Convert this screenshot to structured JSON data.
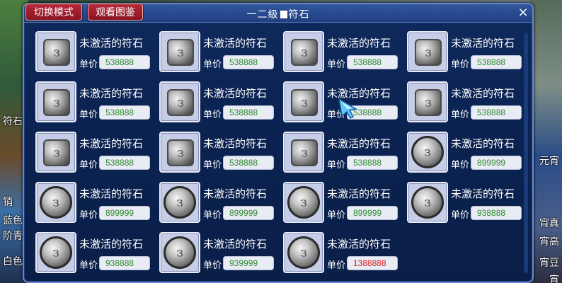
{
  "window": {
    "title_left": "一二级",
    "title_right": "符石",
    "close_glyph": "×"
  },
  "toolbar": {
    "switch_mode": "切换模式",
    "view_catalog": "观看图鉴"
  },
  "side_left": [
    "符石",
    "销",
    "蓝色符",
    "阶青",
    "白色"
  ],
  "side_right": [
    "元宵",
    "宵真",
    "宵高",
    "宵豆",
    "宵"
  ],
  "price_label": "单价",
  "items": [
    {
      "name": "未激活的符石",
      "price": "538888",
      "shape": "square",
      "price_color": "green"
    },
    {
      "name": "未激活的符石",
      "price": "538888",
      "shape": "square",
      "price_color": "green"
    },
    {
      "name": "未激活的符石",
      "price": "538888",
      "shape": "square",
      "price_color": "green"
    },
    {
      "name": "未激活的符石",
      "price": "538888",
      "shape": "square",
      "price_color": "green"
    },
    {
      "name": "未激活的符石",
      "price": "538888",
      "shape": "square",
      "price_color": "green"
    },
    {
      "name": "未激活的符石",
      "price": "538888",
      "shape": "square",
      "price_color": "green"
    },
    {
      "name": "未激活的符石",
      "price": "538888",
      "shape": "square",
      "price_color": "green"
    },
    {
      "name": "未激活的符石",
      "price": "538888",
      "shape": "square",
      "price_color": "green"
    },
    {
      "name": "未激活的符石",
      "price": "538888",
      "shape": "square",
      "price_color": "green"
    },
    {
      "name": "未激活的符石",
      "price": "538888",
      "shape": "square",
      "price_color": "green"
    },
    {
      "name": "未激活的符石",
      "price": "538888",
      "shape": "square",
      "price_color": "green"
    },
    {
      "name": "未激活的符石",
      "price": "899999",
      "shape": "round",
      "price_color": "green"
    },
    {
      "name": "未激活的符石",
      "price": "899999",
      "shape": "round",
      "price_color": "green"
    },
    {
      "name": "未激活的符石",
      "price": "899999",
      "shape": "round",
      "price_color": "green"
    },
    {
      "name": "未激活的符石",
      "price": "899999",
      "shape": "round",
      "price_color": "green"
    },
    {
      "name": "未激活的符石",
      "price": "938888",
      "shape": "round",
      "price_color": "green"
    },
    {
      "name": "未激活的符石",
      "price": "938888",
      "shape": "round",
      "price_color": "green"
    },
    {
      "name": "未激活的符石",
      "price": "939999",
      "shape": "round",
      "price_color": "green"
    },
    {
      "name": "未激活的符石",
      "price": "1388888",
      "shape": "round",
      "price_color": "red"
    }
  ],
  "colors": {
    "panel": "#0b2352",
    "price_green": "#2e8b2e",
    "price_red": "#d82020",
    "button_red": "#b8283a"
  }
}
